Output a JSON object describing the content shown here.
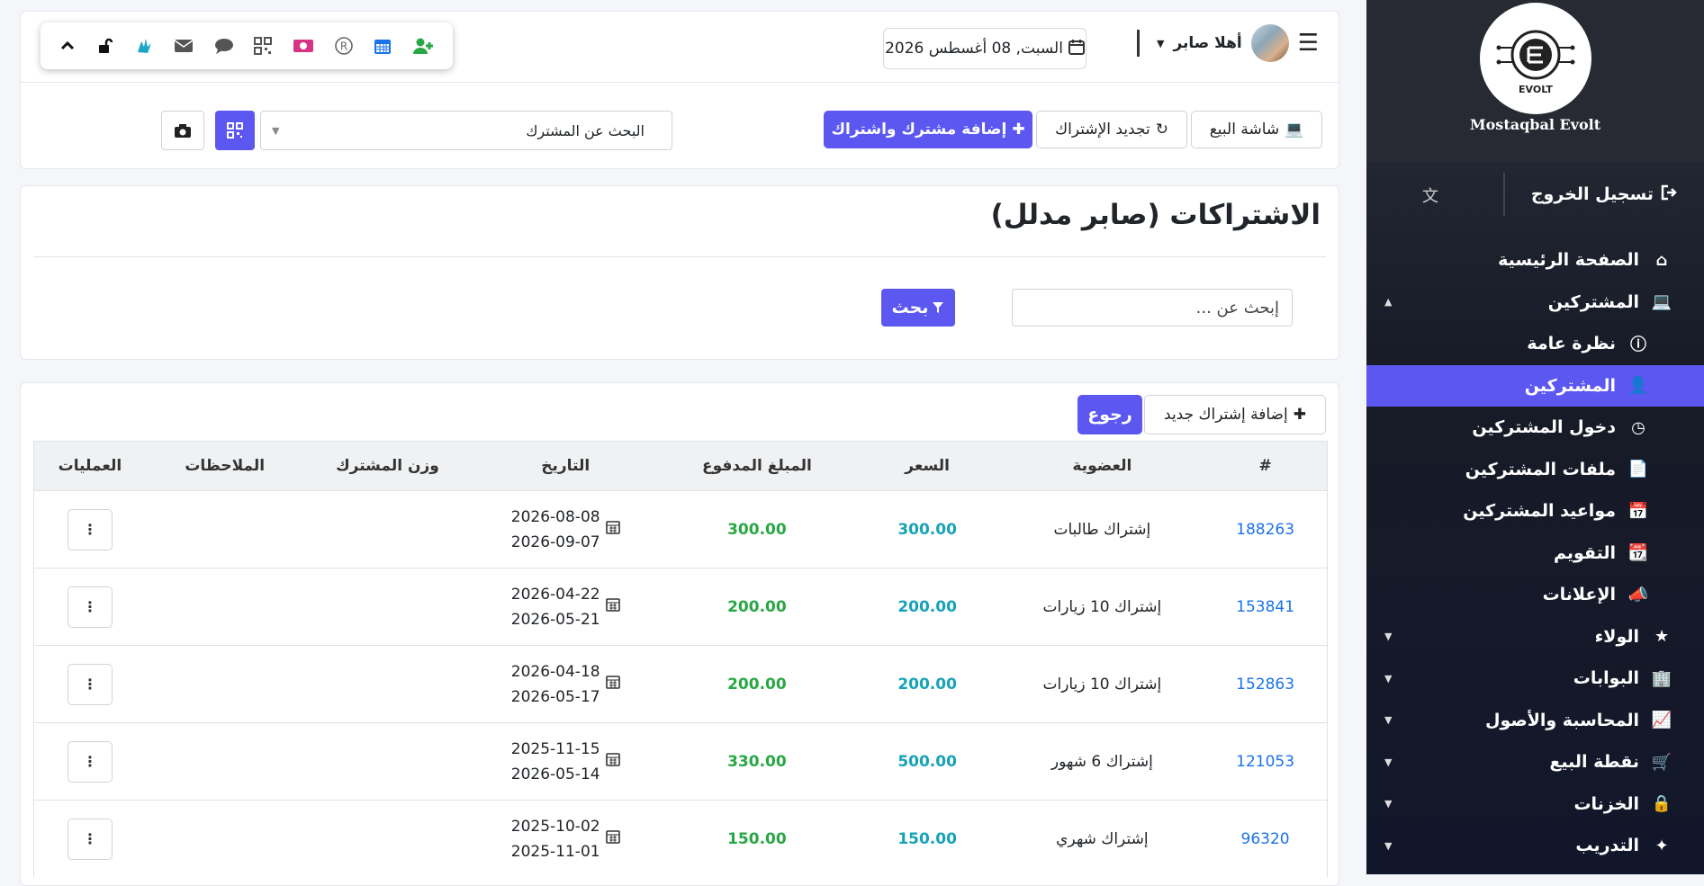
{
  "header": {
    "greeting": "أهلا صابر",
    "date": "السبت, 08 أغسطس 2026",
    "toolbar_icons": [
      "chevron-up-icon",
      "unlock-icon",
      "sign-language-icon",
      "envelope-icon",
      "comment-icon",
      "qrcode-icon",
      "money-icon",
      "registered-icon",
      "calendar-icon",
      "user-plus-icon"
    ]
  },
  "actions": {
    "pos_screen": "شاشة البيع",
    "renew_subscription": "تجديد الإشتراك",
    "add_member_and_subscription": "إضافة مشترك واشتراك",
    "member_search_placeholder": "البحث عن المشترك"
  },
  "page": {
    "title": "الاشتراكات (صابر مدلل)",
    "search_placeholder": "إبحث عن ...",
    "search_button": "بحث",
    "add_new_subscription": "إضافة إشتراك جديد",
    "back_button": "رجوع"
  },
  "table": {
    "columns": [
      "#",
      "العضوية",
      "السعر",
      "المبلغ المدفوع",
      "التاريخ",
      "وزن المشترك",
      "الملاحظات",
      "العمليات"
    ],
    "rows": [
      {
        "id": "188263",
        "membership": "إشتراك طالبات",
        "price": "300.00",
        "paid": "300.00",
        "start": "2026-08-08",
        "end": "2026-09-07"
      },
      {
        "id": "153841",
        "membership": "إشتراك 10 زيارات",
        "price": "200.00",
        "paid": "200.00",
        "start": "2026-04-22",
        "end": "2026-05-21"
      },
      {
        "id": "152863",
        "membership": "إشتراك 10 زيارات",
        "price": "200.00",
        "paid": "200.00",
        "start": "2026-04-18",
        "end": "2026-05-17"
      },
      {
        "id": "121053",
        "membership": "إشتراك 6 شهور",
        "price": "500.00",
        "paid": "330.00",
        "start": "2025-11-15",
        "end": "2026-05-14"
      },
      {
        "id": "96320",
        "membership": "إشتراك شهري",
        "price": "150.00",
        "paid": "150.00",
        "start": "2025-10-02",
        "end": "2025-11-01"
      }
    ]
  },
  "sidebar": {
    "brand": "Mostaqbal Evolt",
    "logout": "تسجيل الخروج",
    "items": [
      {
        "label": "الصفحة الرئيسية",
        "icon": "home-icon"
      },
      {
        "label": "المشتركين",
        "icon": "laptop-icon"
      },
      {
        "label": "نظرة عامة",
        "icon": "info-icon"
      },
      {
        "label": "المشتركين",
        "icon": "user-icon"
      },
      {
        "label": "دخول المشتركين",
        "icon": "clock-icon"
      },
      {
        "label": "ملفات المشتركين",
        "icon": "file-icon"
      },
      {
        "label": "مواعيد المشتركين",
        "icon": "calendar-icon"
      },
      {
        "label": "التقويم",
        "icon": "calendar-grid-icon"
      },
      {
        "label": "الإعلانات",
        "icon": "bullhorn-icon"
      },
      {
        "label": "الولاء",
        "icon": "star-icon"
      },
      {
        "label": "البوابات",
        "icon": "building-icon"
      },
      {
        "label": "المحاسبة والأصول",
        "icon": "chart-line-icon"
      },
      {
        "label": "نقطة البيع",
        "icon": "cart-icon"
      },
      {
        "label": "الخزنات",
        "icon": "lock-icon"
      },
      {
        "label": "التدريب",
        "icon": "wand-icon"
      }
    ]
  },
  "colors": {
    "accent": "#5b57f0",
    "sidebar_bg": "#181c28",
    "link": "#1a73e8",
    "price": "#17a2b8",
    "paid": "#28a745"
  }
}
